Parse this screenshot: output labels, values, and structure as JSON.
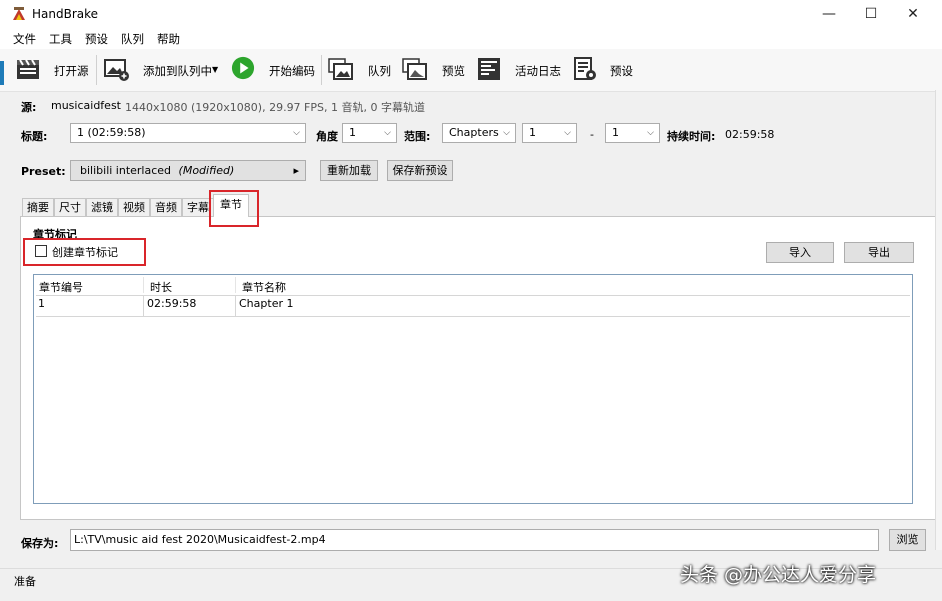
{
  "window": {
    "title": "HandBrake",
    "minimize": "—",
    "maximize": "☐",
    "close": "✕"
  },
  "menu": [
    "文件",
    "工具",
    "预设",
    "队列",
    "帮助"
  ],
  "toolbar": {
    "open_source": "打开源",
    "add_to_queue": "添加到队列中",
    "add_to_queue_arrow": "▼",
    "start_encode": "开始编码",
    "queue": "队列",
    "preview": "预览",
    "activity_log": "活动日志",
    "presets": "预设"
  },
  "source": {
    "label": "源:",
    "name": "musicaidfest",
    "info": "1440x1080 (1920x1080), 29.97 FPS, 1 音轨, 0 字幕轨道"
  },
  "title_row": {
    "title_label": "标题:",
    "title_value": "1  (02:59:58)",
    "angle_label": "角度",
    "angle_value": "1",
    "range_label": "范围:",
    "range_type": "Chapters",
    "range_start": "1",
    "range_dash": "-",
    "range_end": "1",
    "duration_label": "持续时间:",
    "duration_value": "02:59:58"
  },
  "preset_row": {
    "label": "Preset:",
    "name": "bilibili interlaced",
    "modified": "(Modified)",
    "arrow": "▸",
    "reload_button": "重新加载",
    "save_new_button": "保存新预设"
  },
  "tabs": [
    "摘要",
    "尺寸",
    "滤镜",
    "视频",
    "音频",
    "字幕",
    "章节"
  ],
  "active_tab": "章节",
  "chapters": {
    "section_title": "章节标记",
    "create_markers_label": "创建章节标记",
    "create_markers_checked": false,
    "import_button": "导入",
    "export_button": "导出",
    "columns": [
      "章节编号",
      "时长",
      "章节名称"
    ],
    "rows": [
      {
        "number": "1",
        "duration": "02:59:58",
        "name": "Chapter 1"
      }
    ]
  },
  "save": {
    "label": "保存为:",
    "path": "L:\\TV\\music aid fest 2020\\Musicaidfest-2.mp4",
    "browse_button": "浏览"
  },
  "status": {
    "text": "准备"
  },
  "watermark": "头条 @办公达人爱分享",
  "colors": {
    "highlight_red": "#d9252a",
    "play_green": "#2da52d"
  }
}
